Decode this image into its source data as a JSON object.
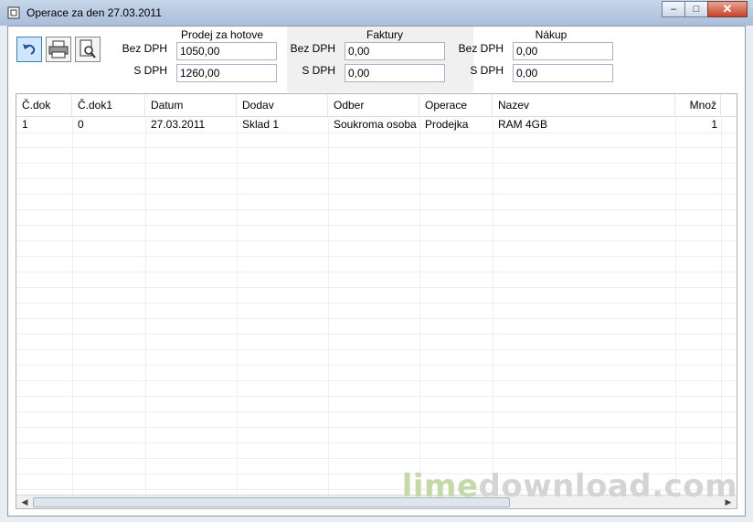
{
  "window": {
    "title": "Operace za den 27.03.2011"
  },
  "groups": {
    "prodej": {
      "title": "Prodej za hotove",
      "bez_label": "Bez DPH",
      "bez_value": "1050,00",
      "s_label": "S DPH",
      "s_value": "1260,00"
    },
    "faktury": {
      "title": "Faktury",
      "bez_label": "Bez DPH",
      "bez_value": "0,00",
      "s_label": "S DPH",
      "s_value": "0,00"
    },
    "nakup": {
      "title": "Nákup",
      "bez_label": "Bez DPH",
      "bez_value": "0,00",
      "s_label": "S DPH",
      "s_value": "0,00"
    }
  },
  "toolbar": {
    "icons": [
      "undo-icon",
      "printer-icon",
      "print-preview-icon"
    ]
  },
  "table": {
    "columns": [
      "Č.dok",
      "Č.dok1",
      "Datum",
      "Dodav",
      "Odber",
      "Operace",
      "Nazev",
      "Množ"
    ],
    "rows": [
      [
        "1",
        "0",
        "27.03.2011",
        "Sklad 1",
        "Soukroma osoba",
        "Prodejka",
        "RAM 4GB",
        "1"
      ]
    ]
  },
  "watermark": {
    "part1": "lime",
    "part2": "download.com"
  },
  "colors": {
    "titlebar": "#b8cbe4",
    "close": "#c7432a",
    "watermark_green": "#c5d9a8"
  }
}
